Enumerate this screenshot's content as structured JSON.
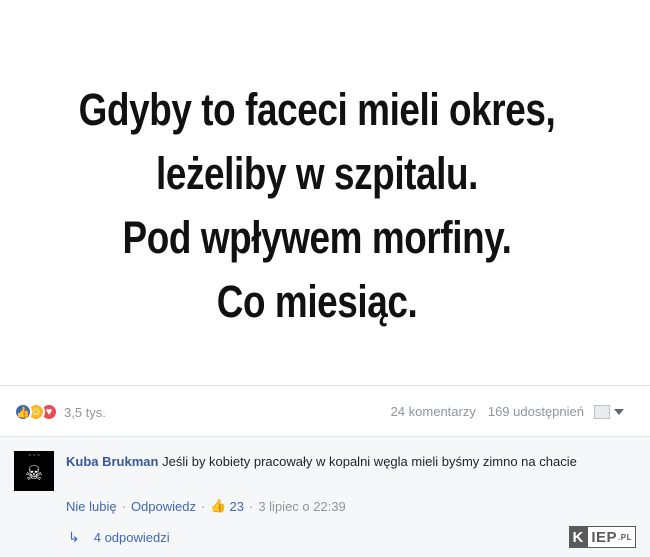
{
  "meme": {
    "lines": [
      "Gdyby to faceci mieli okres,",
      "leżeliby w szpitalu.",
      "Pod wpływem morfiny.",
      "Co miesiąc."
    ]
  },
  "post_bar": {
    "reactions": [
      "like-icon",
      "haha-icon",
      "love-icon"
    ],
    "reaction_count": "3,5 tys.",
    "comments": "24 komentarzy",
    "shares": "169 udostępnień"
  },
  "comment": {
    "author": "Kuba Brukman",
    "text": "Jeśli by kobiety pracowały w kopalni węgla mieli byśmy zimno na chacie",
    "unlike_label": "Nie lubię",
    "reply_label": "Odpowiedz",
    "like_count": "23",
    "timestamp": "3 lipiec o 22:39",
    "replies_label": "4 odpowiedzi"
  },
  "watermark": {
    "k": "K",
    "rest": "IEP",
    "tld": ".PL"
  },
  "colors": {
    "link": "#4267b2",
    "author": "#365899",
    "muted": "#90949c"
  }
}
